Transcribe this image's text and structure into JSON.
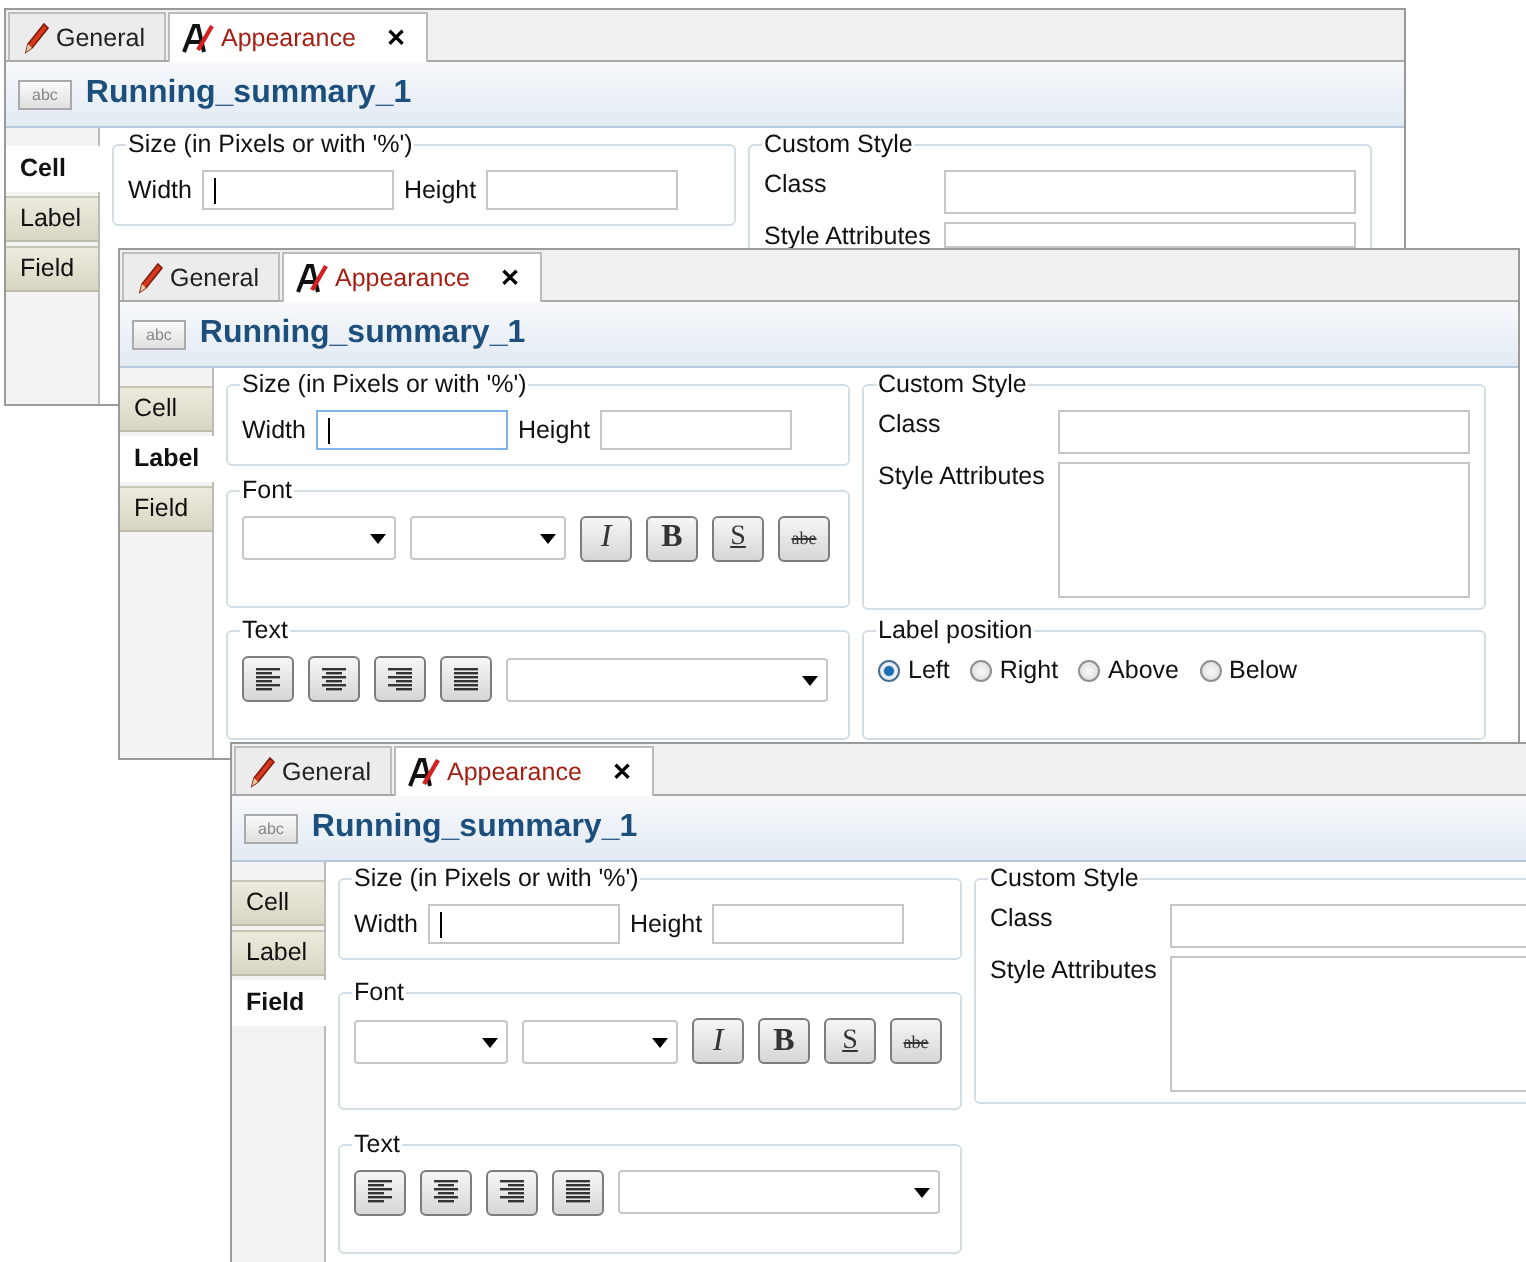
{
  "panels": [
    {
      "tabs": [
        {
          "label": "General",
          "kind": "general",
          "selected": false
        },
        {
          "label": "Appearance",
          "kind": "appearance",
          "selected": true,
          "close": "✕"
        }
      ],
      "badge": "abc",
      "title": "Running_summary_1",
      "side_tabs": [
        {
          "label": "Cell",
          "selected": true
        },
        {
          "label": "Label",
          "selected": false
        },
        {
          "label": "Field",
          "selected": false
        }
      ],
      "size": {
        "legend": "Size (in Pixels or with '%')",
        "width_label": "Width",
        "height_label": "Height",
        "width_focused": false
      },
      "custom_style": {
        "legend": "Custom Style",
        "class_label": "Class",
        "style_label": "Style Attributes"
      }
    },
    {
      "tabs": [
        {
          "label": "General",
          "kind": "general",
          "selected": false
        },
        {
          "label": "Appearance",
          "kind": "appearance",
          "selected": true,
          "close": "✕"
        }
      ],
      "badge": "abc",
      "title": "Running_summary_1",
      "side_tabs": [
        {
          "label": "Cell",
          "selected": false
        },
        {
          "label": "Label",
          "selected": true
        },
        {
          "label": "Field",
          "selected": false
        }
      ],
      "size": {
        "legend": "Size (in Pixels or with '%')",
        "width_label": "Width",
        "height_label": "Height",
        "width_focused": true
      },
      "font": {
        "legend": "Font",
        "style_buttons": [
          {
            "label": "I",
            "kind": "italic"
          },
          {
            "label": "B",
            "kind": "bold"
          },
          {
            "label": "S",
            "kind": "underline"
          },
          {
            "label": "abe",
            "kind": "strike"
          }
        ]
      },
      "text": {
        "legend": "Text",
        "align_buttons": [
          {
            "kind": "left"
          },
          {
            "kind": "center"
          },
          {
            "kind": "right"
          },
          {
            "kind": "justify"
          }
        ]
      },
      "custom_style": {
        "legend": "Custom Style",
        "class_label": "Class",
        "style_label": "Style Attributes"
      },
      "label_position": {
        "legend": "Label position",
        "options": [
          {
            "label": "Left",
            "selected": true
          },
          {
            "label": "Right",
            "selected": false
          },
          {
            "label": "Above",
            "selected": false
          },
          {
            "label": "Below",
            "selected": false
          }
        ]
      }
    },
    {
      "tabs": [
        {
          "label": "General",
          "kind": "general",
          "selected": false
        },
        {
          "label": "Appearance",
          "kind": "appearance",
          "selected": true,
          "close": "✕"
        }
      ],
      "badge": "abc",
      "title": "Running_summary_1",
      "side_tabs": [
        {
          "label": "Cell",
          "selected": false
        },
        {
          "label": "Label",
          "selected": false
        },
        {
          "label": "Field",
          "selected": true
        }
      ],
      "size": {
        "legend": "Size (in Pixels or with '%')",
        "width_label": "Width",
        "height_label": "Height",
        "width_focused": false
      },
      "font": {
        "legend": "Font",
        "style_buttons": [
          {
            "label": "I",
            "kind": "italic"
          },
          {
            "label": "B",
            "kind": "bold"
          },
          {
            "label": "S",
            "kind": "underline"
          },
          {
            "label": "abe",
            "kind": "strike"
          }
        ]
      },
      "text": {
        "legend": "Text",
        "align_buttons": [
          {
            "kind": "left"
          },
          {
            "kind": "center"
          },
          {
            "kind": "right"
          },
          {
            "kind": "justify"
          }
        ]
      },
      "custom_style": {
        "legend": "Custom Style",
        "class_label": "Class",
        "style_label": "Style Attributes"
      }
    }
  ]
}
